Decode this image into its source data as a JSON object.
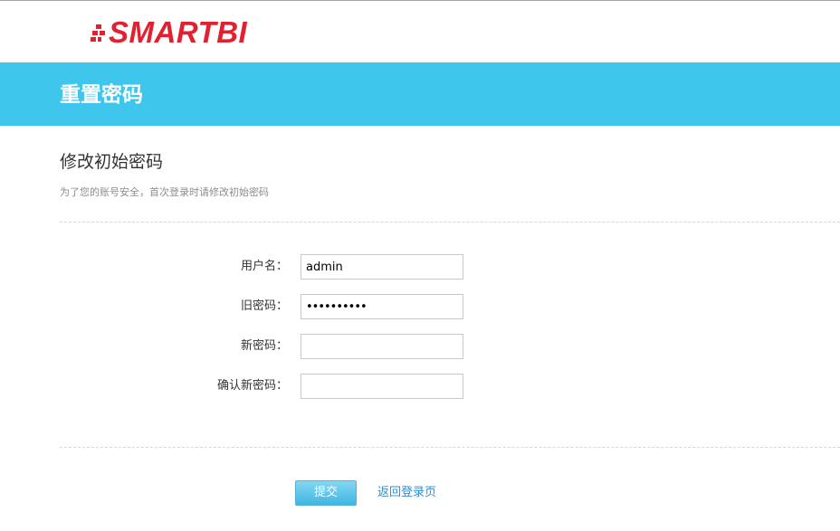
{
  "brand": {
    "logo_text": "SMARTBI",
    "logo_color": "#e3202f",
    "logo_icon": "pixel-mark-icon"
  },
  "banner": {
    "title": "重置密码",
    "background": "#3ec6ec"
  },
  "section": {
    "title": "修改初始密码",
    "hint": "为了您的账号安全，首次登录时请修改初始密码"
  },
  "form": {
    "username": {
      "label": "用户名：",
      "value": "admin"
    },
    "old_password": {
      "label": "旧密码：",
      "value": "••••••••••"
    },
    "new_password": {
      "label": "新密码：",
      "value": ""
    },
    "confirm_password": {
      "label": "确认新密码：",
      "value": ""
    }
  },
  "actions": {
    "submit_label": "提交",
    "back_link_label": "返回登录页",
    "accent": "#3fb6e2",
    "link_color": "#2f8ed3"
  }
}
